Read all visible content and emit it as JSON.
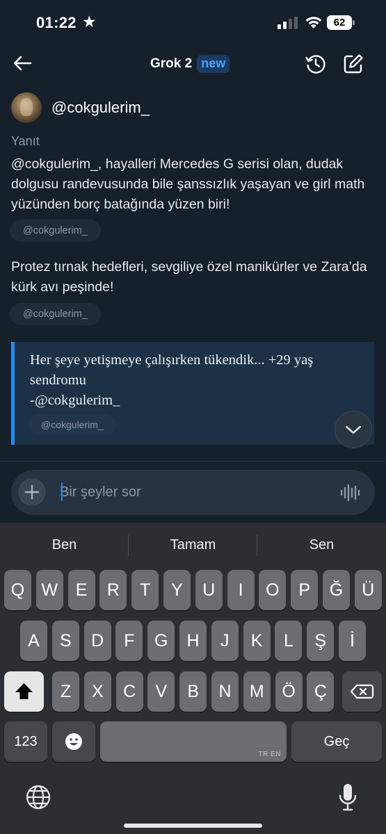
{
  "status_bar": {
    "time": "01:22",
    "battery": "62"
  },
  "header": {
    "title": "Grok 2",
    "badge": "new"
  },
  "message": {
    "username": "@cokgulerim_",
    "reply_label": "Yanıt",
    "paragraph1": "@cokgulerim_, hayalleri Mercedes G serisi olan, dudak dolgusu randevusunda bile şanssızlık yaşayan ve girl math yüzünden borç batağında yüzen biri!",
    "chip1": "@cokgulerim_",
    "paragraph2": "Protez tırnak hedefleri, sevgiliye özel manikürler ve Zara’da kürk avı peşinde!",
    "chip2": "@cokgulerim_",
    "quote_line1": "Her şeye yetişmeye çalışırken tükendik... +29 yaş sendromu",
    "quote_line2": "-@cokgulerim_",
    "quote_chip": "@cokgulerim_"
  },
  "input": {
    "placeholder": "Bir şeyler sor"
  },
  "keyboard": {
    "suggestions": [
      "Ben",
      "Tamam",
      "Sen"
    ],
    "row1": [
      "Q",
      "W",
      "E",
      "R",
      "T",
      "Y",
      "U",
      "I",
      "O",
      "P",
      "Ğ",
      "Ü"
    ],
    "row2": [
      "A",
      "S",
      "D",
      "F",
      "G",
      "H",
      "J",
      "K",
      "L",
      "Ş",
      "İ"
    ],
    "row3": [
      "Z",
      "X",
      "C",
      "V",
      "B",
      "N",
      "M",
      "Ö",
      "Ç"
    ],
    "numbers_label": "123",
    "space_lang": "TR EN",
    "return_label": "Geç"
  },
  "colors": {
    "accent": "#1d8cf8",
    "background": "#15202b",
    "badge_text": "#4aa3ff"
  }
}
